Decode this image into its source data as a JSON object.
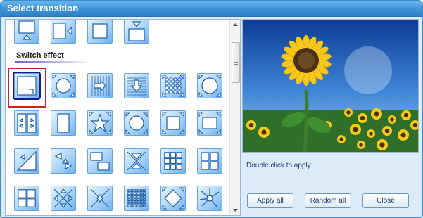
{
  "window": {
    "title": "Select transition"
  },
  "effects": {
    "section_title": "Switch effect",
    "selected": "switch-effect-1"
  },
  "preview": {
    "hint": "Double click to apply",
    "sky_color": "#2d6fc7",
    "field_color": "#2f6f2a",
    "petal_color": "#f7c81c",
    "center_color": "#4a3015"
  },
  "buttons": {
    "apply_all": "Apply all",
    "random_all": "Random all",
    "close": "Close"
  },
  "colors": {
    "title_bar": "#3d92d6",
    "tile_fill": "#a9d3f7",
    "selection_outline": "#c0282d",
    "button_text": "#1b3e73"
  }
}
